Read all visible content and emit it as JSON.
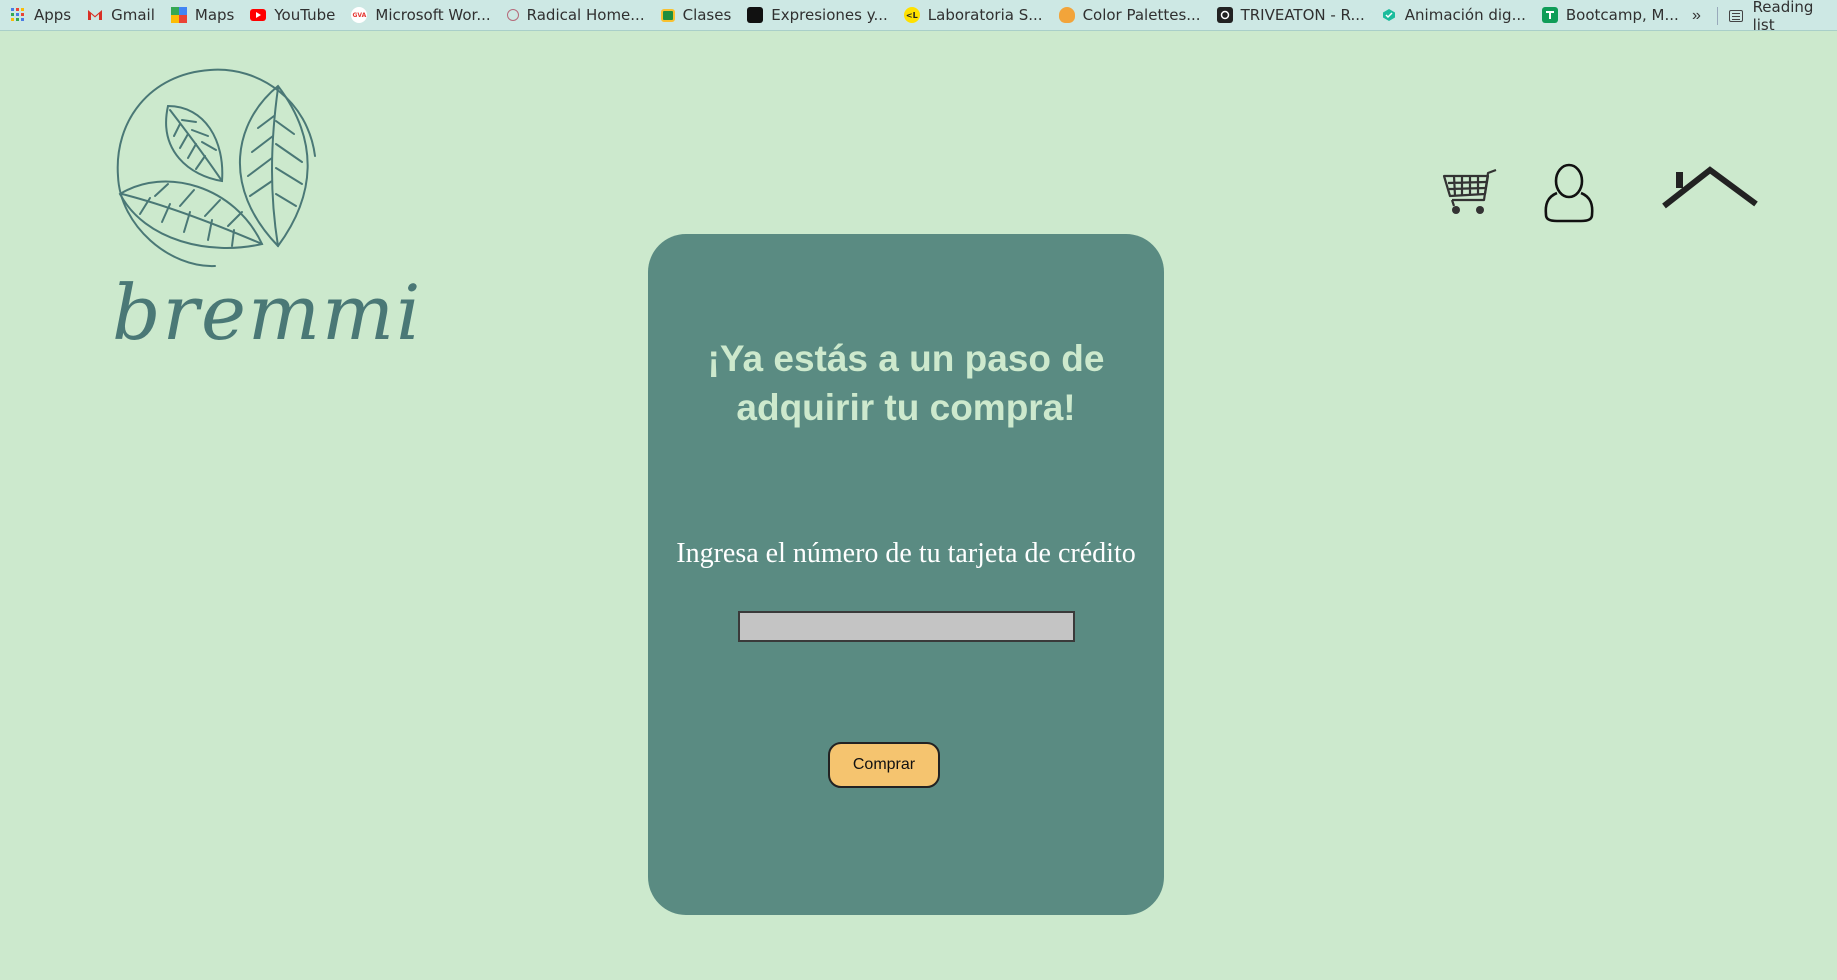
{
  "bookmarks": {
    "items": [
      {
        "label": "Apps",
        "icon": "apps-grid-icon",
        "color": "#4a7be5"
      },
      {
        "label": "Gmail",
        "icon": "gmail-icon",
        "color": "#d93025"
      },
      {
        "label": "Maps",
        "icon": "maps-icon",
        "color": "#34a853"
      },
      {
        "label": "YouTube",
        "icon": "youtube-icon",
        "color": "#ff0000"
      },
      {
        "label": "Microsoft Wor...",
        "icon": "gva-icon",
        "color": "#e53935"
      },
      {
        "label": "Radical Home...",
        "icon": "radical-icon",
        "color": "#b56a7a"
      },
      {
        "label": "Clases",
        "icon": "classroom-icon",
        "color": "#1e8e3e"
      },
      {
        "label": "Expresiones y...",
        "icon": "expresiones-icon",
        "color": "#111111"
      },
      {
        "label": "Laboratoria S...",
        "icon": "laboratoria-icon",
        "color": "#ffe100"
      },
      {
        "label": "Color Palettes...",
        "icon": "color-palettes-icon",
        "color": "#e07030"
      },
      {
        "label": "TRIVEATON - R...",
        "icon": "triveaton-icon",
        "color": "#222222"
      },
      {
        "label": "Animación dig...",
        "icon": "animacion-icon",
        "color": "#1abc9c"
      },
      {
        "label": "Bootcamp, M...",
        "icon": "bootcamp-icon",
        "color": "#0f9d58"
      }
    ],
    "more": "»",
    "reading_list": "Reading list"
  },
  "brand": {
    "name": "bremmi",
    "color": "#4a7876"
  },
  "header_icons": {
    "cart": "cart-icon",
    "user": "user-icon",
    "home": "home-icon"
  },
  "card": {
    "title": "¡Ya estás a un paso de adquirir tu compra!",
    "label": "Ingresa el número de tu tarjeta de crédito",
    "input_value": "",
    "button": "Comprar",
    "background": "#5a8b82",
    "button_color": "#f5c46f"
  },
  "colors": {
    "page_background": "#cce9cd",
    "title_color": "#cde9cd"
  }
}
